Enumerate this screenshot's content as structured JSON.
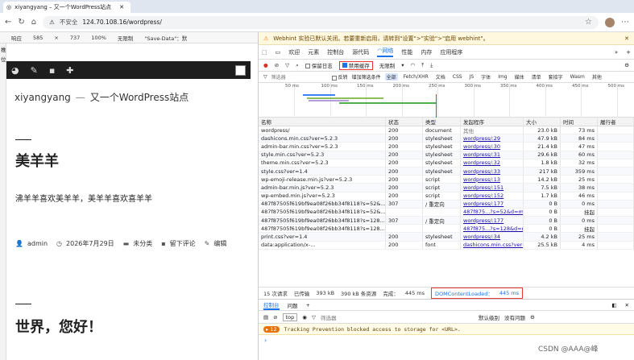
{
  "browser": {
    "tab_title": "xiyangyang – 又一个WordPress站点",
    "back_icon": "←",
    "reload_icon": "↻",
    "home_icon": "⌂",
    "not_secure": "不安全",
    "url": "124.70.108.16/wordpress/",
    "star_icon": "☆",
    "menu_icon": "⋯"
  },
  "sim": {
    "device": "响应",
    "width": "585",
    "x": "×",
    "height": "737",
    "zoom": "100%",
    "throttle": "无限制",
    "save_data": "\"Save-Data\"：默"
  },
  "left_edge": {
    "label1": "推",
    "label2": "位"
  },
  "page": {
    "site_title": "xiyangyang",
    "site_sep": "—",
    "site_desc": "又一个WordPress站点",
    "post1_title": "美羊羊",
    "post1_body": "沸羊羊喜欢美羊羊，美羊羊喜欢喜羊羊",
    "author": "admin",
    "date": "2026年7月29日",
    "category": "未分类",
    "comment": "留下评论",
    "edit": "编辑",
    "post2_title": "世界，您好！"
  },
  "webhint": {
    "text": "Webhint 实验已默认关闭。若要重新启用，请转到\"设置\">\"实验\">\"启用 webhint\"。"
  },
  "devtools_tabs": [
    "欢迎",
    "元素",
    "控制台",
    "源代码",
    "网络",
    "性能",
    "内存",
    "应用程序"
  ],
  "netbar": {
    "preserve_log": "保留日志",
    "disable_cache": "禁用缓存",
    "throttle": "无限制"
  },
  "filter": {
    "placeholder": "筛选器",
    "invert": "反转",
    "more": "增加筛选条件",
    "chips": [
      "全部",
      "Fetch/XHR",
      "文档",
      "CSS",
      "JS",
      "字体",
      "Img",
      "媒体",
      "清单",
      "套接字",
      "Wasm",
      "其他"
    ]
  },
  "timeline_ticks": [
    "50 ms",
    "100 ms",
    "150 ms",
    "200 ms",
    "250 ms",
    "300 ms",
    "350 ms",
    "400 ms",
    "450 ms",
    "500 ms"
  ],
  "table": {
    "headers": [
      "名称",
      "状态",
      "类型",
      "发起程序",
      "大小",
      "时间",
      "履行者"
    ],
    "rows": [
      [
        "wordpress/",
        "200",
        "document",
        "其他",
        "23.0 kB",
        "73 ms",
        ""
      ],
      [
        "dashicons.min.css?ver=5.2.3",
        "200",
        "stylesheet",
        "wordpress/:29",
        "47.9 kB",
        "84 ms",
        ""
      ],
      [
        "admin-bar.min.css?ver=5.2.3",
        "200",
        "stylesheet",
        "wordpress/:30",
        "21.4 kB",
        "47 ms",
        ""
      ],
      [
        "style.min.css?ver=5.2.3",
        "200",
        "stylesheet",
        "wordpress/:31",
        "29.6 kB",
        "60 ms",
        ""
      ],
      [
        "theme.min.css?ver=5.2.3",
        "200",
        "stylesheet",
        "wordpress/:32",
        "1.8 kB",
        "32 ms",
        ""
      ],
      [
        "style.css?ver=1.4",
        "200",
        "stylesheet",
        "wordpress/:33",
        "217 kB",
        "359 ms",
        ""
      ],
      [
        "wp-emoji-release.min.js?ver=5.2.3",
        "200",
        "script",
        "wordpress/:13",
        "14.2 kB",
        "25 ms",
        ""
      ],
      [
        "admin-bar.min.js?ver=5.2.3",
        "200",
        "script",
        "wordpress/:151",
        "7.5 kB",
        "38 ms",
        ""
      ],
      [
        "wp-embed.min.js?ver=5.2.3",
        "200",
        "script",
        "wordpress/:152",
        "1.7 kB",
        "46 ms",
        ""
      ],
      [
        "487f87505f619bf9ea08f26bb34f8118?s=52&...",
        "307",
        "/ 重定向",
        "wordpress/:177",
        "0 B",
        "0 ms",
        ""
      ],
      [
        "487f87505f619bf9ea08f26bb34f8118?s=52&...",
        "",
        "",
        "487f875...?s=52&d=mm&...",
        "0 B",
        "挂起",
        ""
      ],
      [
        "487f87505f619bf9ea08f26bb34f8118?s=128...",
        "307",
        "/ 重定向",
        "wordpress/:177",
        "0 B",
        "0 ms",
        ""
      ],
      [
        "487f87505f619bf9ea08f26bb34f8118?s=128...",
        "",
        "",
        "487f875...?s=128&d=mm&...",
        "0 B",
        "挂起",
        ""
      ],
      [
        "print.css?ver=1.4",
        "200",
        "stylesheet",
        "wordpress/:34",
        "4.2 kB",
        "25 ms",
        ""
      ],
      [
        "data:application/x-...",
        "200",
        "font",
        "dashicons.min.css?ver=5.2...",
        "25.5 kB",
        "4 ms",
        ""
      ]
    ]
  },
  "summary": {
    "requests": "15 次请求",
    "transferred": "已传输",
    "transferred_v": "393 kB",
    "resources": "390 kB 条资源",
    "finish": "完成：",
    "finish_v": "445 ms",
    "dcl": "DOMContentLoaded：",
    "dcl_v": "445 ms"
  },
  "drawer": {
    "tabs": [
      "控制台",
      "问题"
    ],
    "top": "top",
    "filter": "筛选器",
    "level": "默认级别",
    "issues": "没有问题"
  },
  "console": {
    "badge": "12",
    "message": "Tracking Prevention blocked access to storage for <URL>.",
    "prompt": "›"
  },
  "watermark": "CSDN @AAA@峰"
}
